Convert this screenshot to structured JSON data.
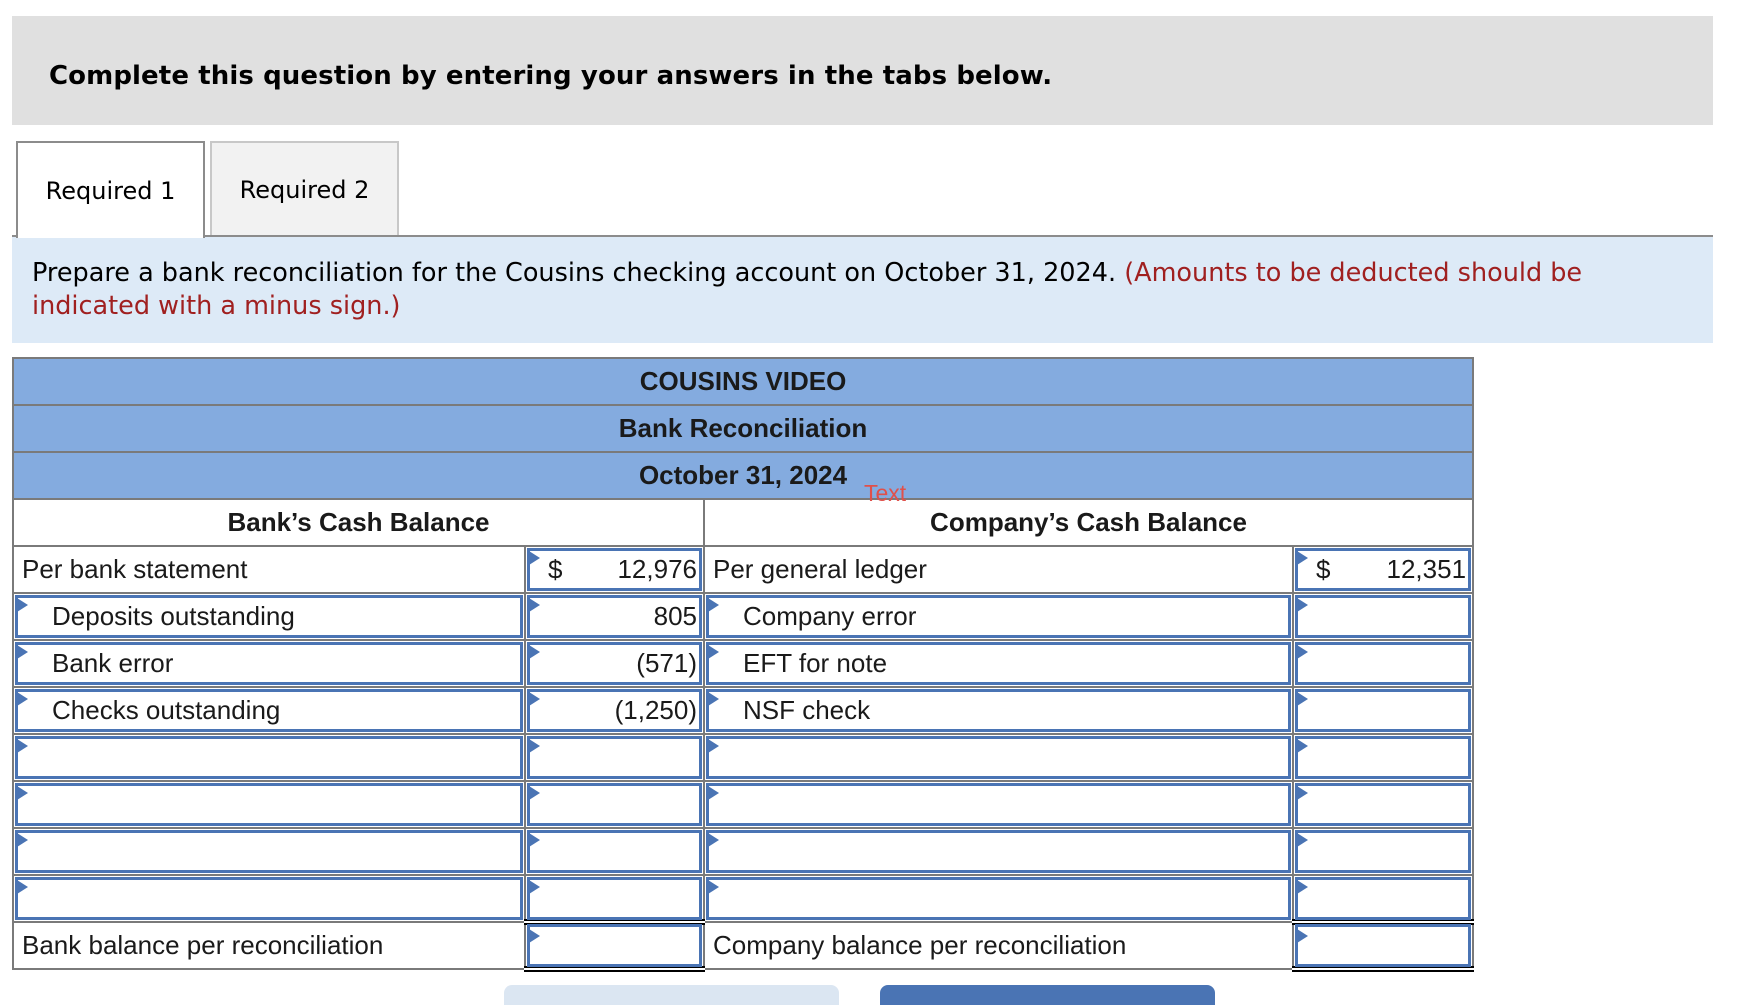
{
  "banner": {
    "text": "Complete this question by entering your answers in the tabs below."
  },
  "tabs": [
    {
      "label": "Required 1",
      "active": true
    },
    {
      "label": "Required 2",
      "active": false
    }
  ],
  "instructions": {
    "text": "Prepare a bank reconciliation for the Cousins checking account on October 31, 2024.",
    "note": "(Amounts to be deducted should be indicated with a minus sign.)"
  },
  "reconciliation": {
    "company": "COUSINS VIDEO",
    "title": "Bank Reconciliation",
    "date": "October 31, 2024",
    "overlay_tag": "Text",
    "bank_header": "Bank’s Cash Balance",
    "company_header": "Company’s Cash Balance",
    "currency_symbol": "$",
    "bank_rows": [
      {
        "label": "Per bank statement",
        "amount": "12,976"
      },
      {
        "label": "Deposits outstanding",
        "amount": "805"
      },
      {
        "label": "Bank error",
        "amount": "(571)"
      },
      {
        "label": "Checks outstanding",
        "amount": "(1,250)"
      },
      {
        "label": "",
        "amount": ""
      },
      {
        "label": "",
        "amount": ""
      },
      {
        "label": "",
        "amount": ""
      },
      {
        "label": "",
        "amount": ""
      }
    ],
    "company_rows": [
      {
        "label": "Per general ledger",
        "amount": "12,351"
      },
      {
        "label": "Company error",
        "amount": ""
      },
      {
        "label": "EFT for note",
        "amount": ""
      },
      {
        "label": "NSF check",
        "amount": ""
      },
      {
        "label": "",
        "amount": ""
      },
      {
        "label": "",
        "amount": ""
      },
      {
        "label": "",
        "amount": ""
      },
      {
        "label": "",
        "amount": ""
      }
    ],
    "bank_total_label": "Bank balance per reconciliation",
    "bank_total_amount": "",
    "company_total_label": "Company balance per reconciliation",
    "company_total_amount": ""
  },
  "colors": {
    "header_blue": "#84abdf",
    "input_blue": "#4a74b4",
    "note_red": "#a02020",
    "instr_bg": "#ddeaf7"
  }
}
